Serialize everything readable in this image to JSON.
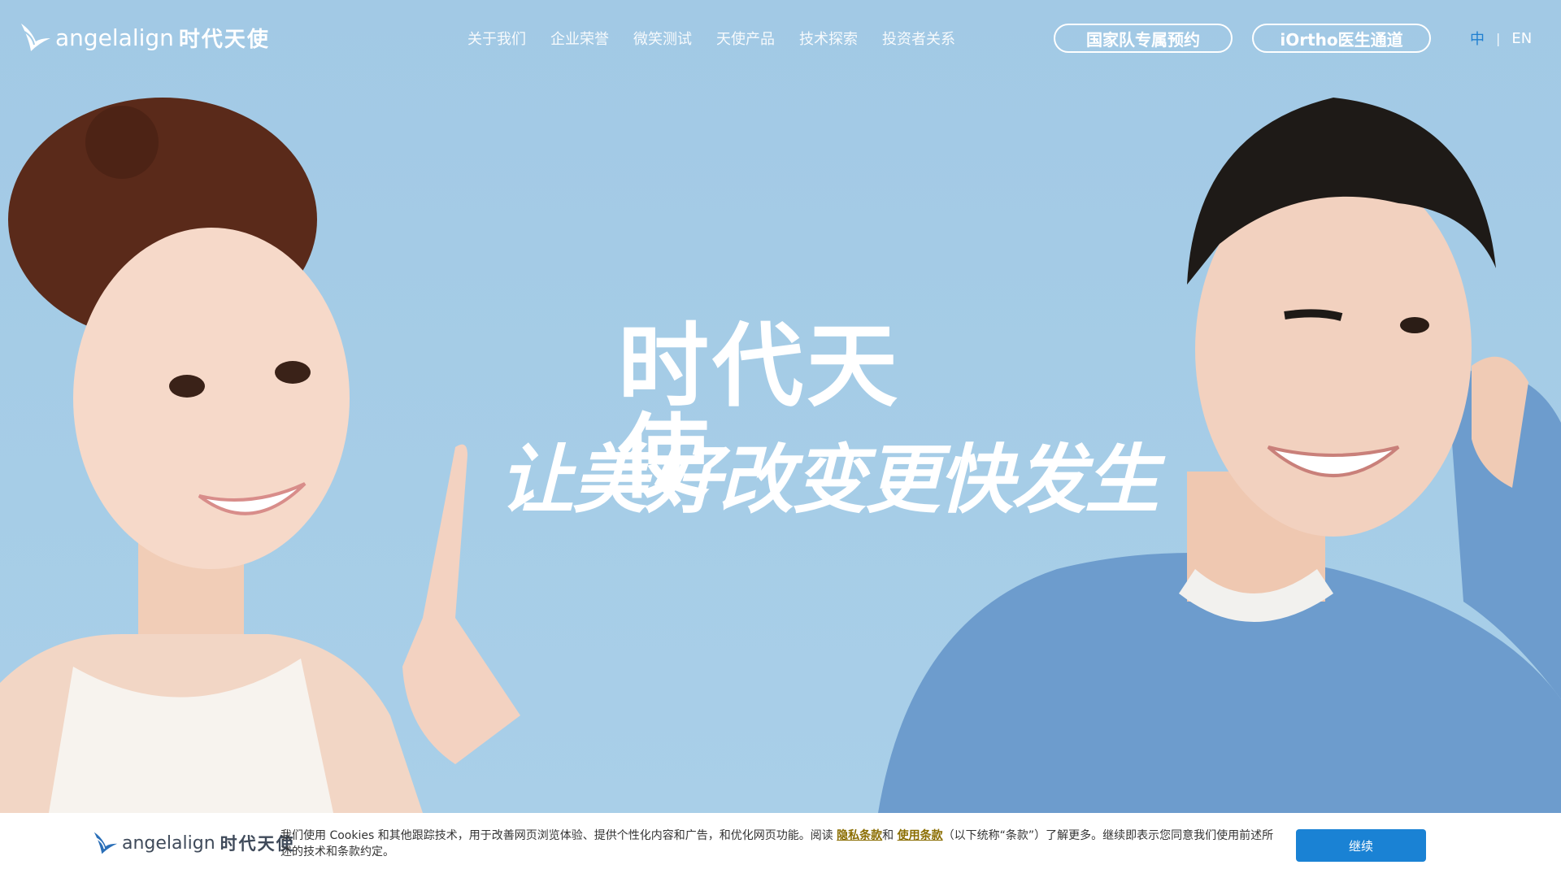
{
  "header": {
    "logo_en": "angelalign",
    "logo_cn": "时代天使",
    "nav": [
      "关于我们",
      "企业荣誉",
      "微笑测试",
      "天使产品",
      "技术探索",
      "投资者关系"
    ],
    "cta_primary": "国家队专属预约",
    "cta_secondary": "iOrtho医生通道",
    "lang_zh": "中",
    "lang_sep": "|",
    "lang_en": "EN"
  },
  "hero": {
    "title": "时代天使",
    "slogan": "让美好改变更快发生"
  },
  "cookie": {
    "logo_en": "angelalign",
    "logo_cn": "时代天使",
    "text_before": "我们使用 Cookies 和其他跟踪技术，用于改善网页浏览体验、提供个性化内容和广告，和优化网页功能。阅读 ",
    "privacy_link": "隐私条款",
    "and": "和 ",
    "terms_link": "使用条款",
    "text_after": "（以下统称“条款”）了解更多。继续即表示您同意我们使用前述所述的技术和条款约定。",
    "continue_button": "继续"
  },
  "colors": {
    "hero_bg": "#a3cbe6",
    "accent_blue": "#1a82d4",
    "link_gold": "#8a6d00"
  }
}
